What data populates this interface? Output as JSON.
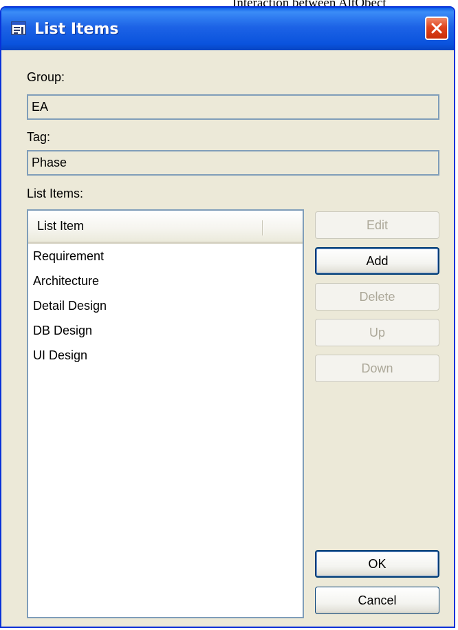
{
  "page_header": {
    "text": "Interaction between AltObect"
  },
  "window": {
    "title": "List Items",
    "icon": "list-window-icon",
    "close_icon": "close-icon",
    "accent_color": "#0a53dd",
    "close_color": "#e0441d"
  },
  "form": {
    "group_label": "Group:",
    "group_value": "EA",
    "tag_label": "Tag:",
    "tag_value": "Phase",
    "list_items_label": "List Items:"
  },
  "list": {
    "column_header": "List Item",
    "items": [
      "Requirement",
      "Architecture",
      "Detail Design",
      "DB Design",
      "UI Design"
    ]
  },
  "buttons": {
    "edit": {
      "label": "Edit",
      "enabled": false
    },
    "add": {
      "label": "Add",
      "enabled": true
    },
    "delete": {
      "label": "Delete",
      "enabled": false
    },
    "up": {
      "label": "Up",
      "enabled": false
    },
    "down": {
      "label": "Down",
      "enabled": false
    },
    "ok": {
      "label": "OK",
      "enabled": true
    },
    "cancel": {
      "label": "Cancel",
      "enabled": true
    }
  }
}
